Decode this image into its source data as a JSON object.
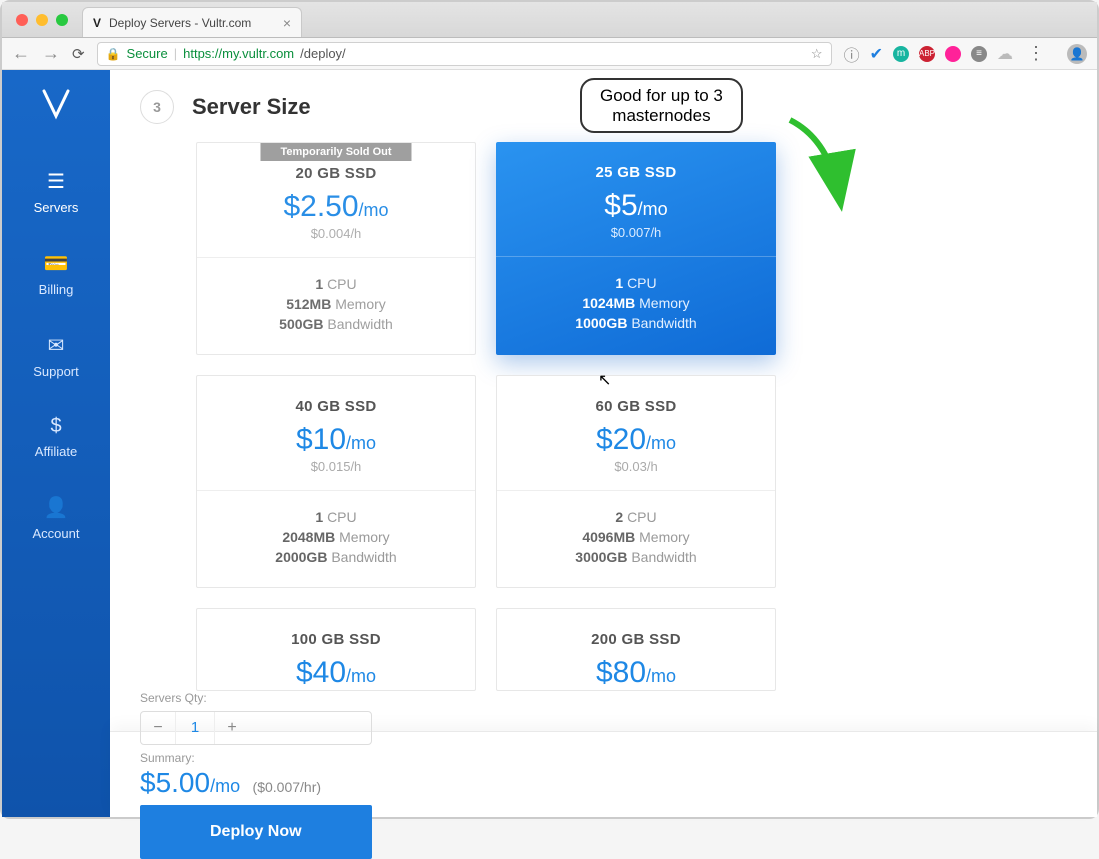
{
  "browser": {
    "tab_title": "Deploy Servers - Vultr.com",
    "secure_label": "Secure",
    "url_host": "https://my.vultr.com",
    "url_path": "/deploy/"
  },
  "sidebar": {
    "items": [
      {
        "label": "Servers"
      },
      {
        "label": "Billing"
      },
      {
        "label": "Support"
      },
      {
        "label": "Affiliate"
      },
      {
        "label": "Account"
      }
    ]
  },
  "section": {
    "step": "3",
    "title": "Server Size"
  },
  "callout": {
    "line1": "Good for up to 3",
    "line2": "masternodes"
  },
  "plans": [
    {
      "ssd": "20 GB SSD",
      "price": "$2.50",
      "per": "/mo",
      "hourly": "$0.004/h",
      "cpu": "1",
      "cpu_label": "CPU",
      "mem": "512MB",
      "mem_label": "Memory",
      "bw": "500GB",
      "bw_label": "Bandwidth",
      "soldout": "Temporarily Sold Out"
    },
    {
      "ssd": "25 GB SSD",
      "price": "$5",
      "per": "/mo",
      "hourly": "$0.007/h",
      "cpu": "1",
      "cpu_label": "CPU",
      "mem": "1024MB",
      "mem_label": "Memory",
      "bw": "1000GB",
      "bw_label": "Bandwidth"
    },
    {
      "ssd": "40 GB SSD",
      "price": "$10",
      "per": "/mo",
      "hourly": "$0.015/h",
      "cpu": "1",
      "cpu_label": "CPU",
      "mem": "2048MB",
      "mem_label": "Memory",
      "bw": "2000GB",
      "bw_label": "Bandwidth"
    },
    {
      "ssd": "60 GB SSD",
      "price": "$20",
      "per": "/mo",
      "hourly": "$0.03/h",
      "cpu": "2",
      "cpu_label": "CPU",
      "mem": "4096MB",
      "mem_label": "Memory",
      "bw": "3000GB",
      "bw_label": "Bandwidth"
    },
    {
      "ssd": "100 GB SSD",
      "price": "$40",
      "per": "/mo"
    },
    {
      "ssd": "200 GB SSD",
      "price": "$80",
      "per": "/mo"
    }
  ],
  "footer": {
    "qty_label": "Servers Qty:",
    "qty": "1",
    "summary_label": "Summary:",
    "summary_price": "$5.00",
    "summary_per": "/mo",
    "summary_hourly": "($0.007/hr)",
    "deploy": "Deploy Now"
  }
}
